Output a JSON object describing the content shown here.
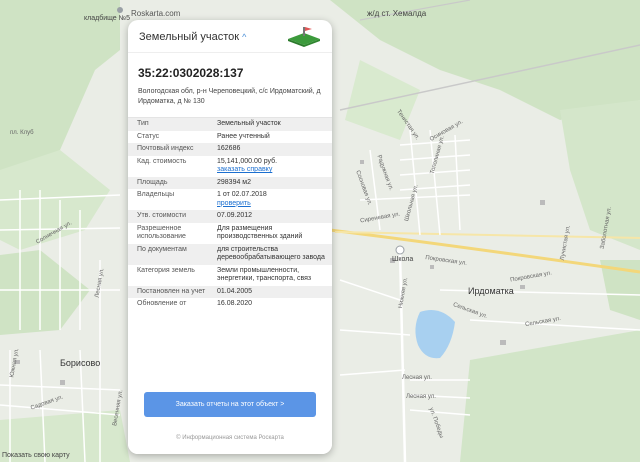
{
  "map": {
    "labels": {
      "cemetery": "кладбище №5",
      "station": "ж/д ст. Хемалда",
      "school": "Школа",
      "village": "Ирдоматка",
      "borisovo": "Борисово",
      "show_map": "Показать свою карту"
    },
    "streets": {
      "tenistaya": "Тенистая ул.",
      "osinovaya": "Осиновая ул.",
      "topolinaya": "Тополиная ул.",
      "sosnovaya": "Сосновая ул.",
      "sirenevaya": "Сиреневая ул.",
      "shkolnaya": "Школьная ул.",
      "radujnaya": "Радужная ул.",
      "pokrovskaya1": "Покровская ул.",
      "pokrovskaya2": "Покровская ул.",
      "selskaya1": "Сельская ул.",
      "selskaya2": "Сельская ул.",
      "lesnaya1": "Лесная ул.",
      "lesnaya2": "Лесная ул.",
      "lesnaya3": "Лесная ул.",
      "nizhnyaya": "Нижняя ул.",
      "yuzhnaya": "Южная ул.",
      "sadovaya": "Садовая ул.",
      "solnechnaya": "Солнечная ул.",
      "vesennyaya": "Весенняя ул.",
      "pobedy": "ул. Победы",
      "luchistaya": "Лучистая ул.",
      "zabudnaya": "Заболотная ул.",
      "pl_klub": "пл. Клуб"
    },
    "watermark": "Roskarta.com"
  },
  "panel": {
    "title": "Земельный участок",
    "cadastral_number": "35:22:0302028:137",
    "address": "Вологодская обл, р-н Череповецкий, с/с Ирдоматский, д Ирдоматка, д № 130",
    "rows": [
      {
        "key": "Тип",
        "value": "Земельный участок"
      },
      {
        "key": "Статус",
        "value": "Ранее учтенный"
      },
      {
        "key": "Почтовый индекс",
        "value": "162686"
      },
      {
        "key": "Кад. стоимость",
        "value": "15,141,000.00 руб.",
        "link": "заказать справку"
      },
      {
        "key": "Площадь",
        "value": "298394 м2"
      },
      {
        "key": "Владельцы",
        "value": "1 от 02.07.2018",
        "link": "проверить"
      },
      {
        "key": "Утв. стоимости",
        "value": "07.09.2012"
      },
      {
        "key": "Разрешенное использование",
        "value": "Для размещения производственных зданий"
      },
      {
        "key": "По документам",
        "value": "для строительства деревообрабатывающего завода"
      },
      {
        "key": "Категория земель",
        "value": "Земли промышленности, энергетики, транспорта, связ"
      },
      {
        "key": "Постановлен на учет",
        "value": "01.04.2005"
      },
      {
        "key": "Обновление от",
        "value": "16.08.2020"
      }
    ],
    "cta_label": "Заказать отчеты на этот объект >",
    "footer": "© Информационная система Роскарта"
  }
}
